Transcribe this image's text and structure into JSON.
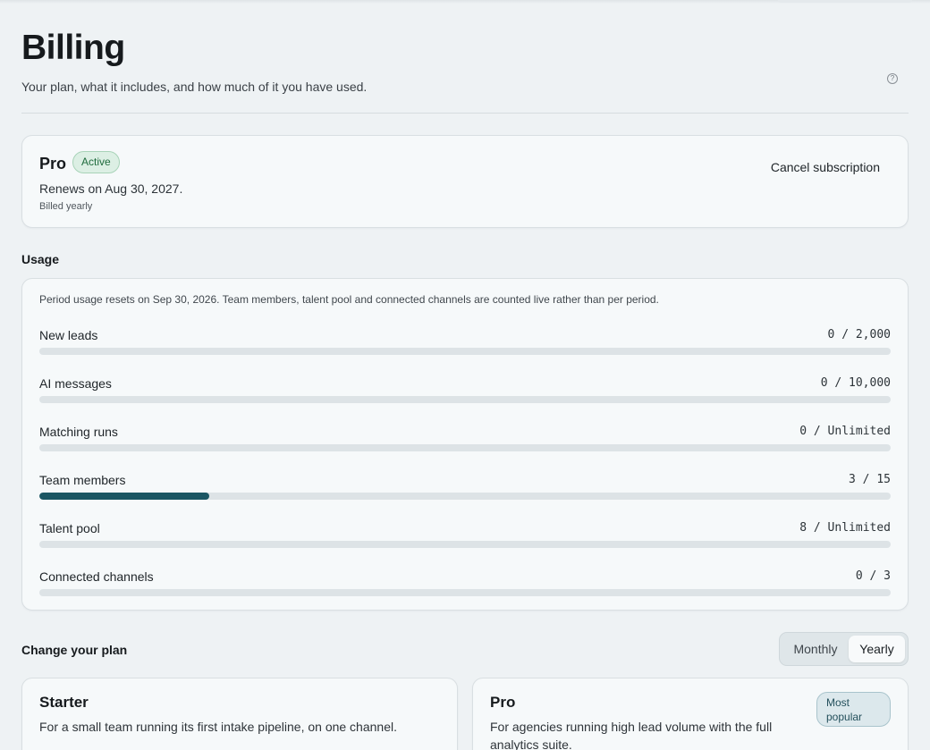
{
  "header": {
    "title": "Billing",
    "subtitle": "Your plan, what it includes, and how much of it you have used.",
    "help_icon": "question-circle-icon",
    "help_glyph": "?"
  },
  "current_plan": {
    "name": "Pro",
    "status": "Active",
    "renews": "Renews on Aug 30, 2027.",
    "billing": "Billed yearly",
    "cancel_label": "Cancel subscription"
  },
  "usage": {
    "heading": "Usage",
    "note": "Period usage resets on Sep 30, 2026. Team members, talent pool and connected channels are counted live rather than per period.",
    "meters": [
      {
        "label": "New leads",
        "value": "0 / 2,000",
        "used_fraction": 0
      },
      {
        "label": "AI messages",
        "value": "0 / 10,000",
        "used_fraction": 0
      },
      {
        "label": "Matching runs",
        "value": "0 / Unlimited",
        "used_fraction": 0
      },
      {
        "label": "Team members",
        "value": "3 / 15",
        "used_fraction": 0.2
      },
      {
        "label": "Talent pool",
        "value": "8 / Unlimited",
        "used_fraction": 0
      },
      {
        "label": "Connected channels",
        "value": "0 / 3",
        "used_fraction": 0
      }
    ],
    "accent_color": "#1b5663"
  },
  "change_plan": {
    "heading": "Change your plan",
    "toggle": {
      "monthly": "Monthly",
      "yearly": "Yearly",
      "selected": "Yearly"
    },
    "plans": [
      {
        "name": "Starter",
        "description": "For a small team running its first intake pipeline, on one channel."
      },
      {
        "name": "Pro",
        "description": "For agencies running high lead volume with the full analytics suite.",
        "badge": "Most popular"
      }
    ]
  }
}
